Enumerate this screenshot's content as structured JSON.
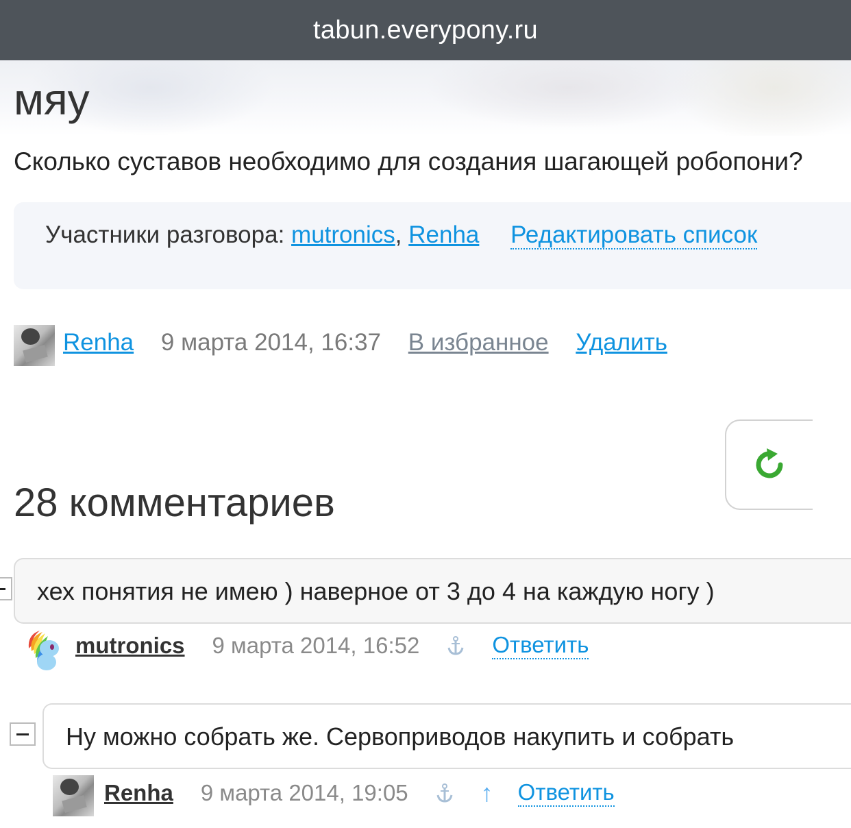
{
  "browser": {
    "url": "tabun.everypony.ru"
  },
  "talk": {
    "title": "мяу",
    "text": "Сколько суставов необходимо для создания шагающей робопони?",
    "participants_label": "Участники разговора:",
    "participants": [
      "mutronics",
      "Renha"
    ],
    "separator": ",",
    "edit_list_label": "Редактировать список",
    "author": "Renha",
    "date": "9 марта 2014, 16:37",
    "favourite_label": "В избранное",
    "delete_label": "Удалить"
  },
  "comments": {
    "header": "28 комментариев",
    "items": [
      {
        "text": "хех понятия не имею ) наверное от 3 до 4 на каждую ногу )",
        "author": "mutronics",
        "date": "9 марта 2014, 16:52",
        "reply_label": "Ответить"
      },
      {
        "text": "Ну можно собрать же. Сервоприводов накупить и собрать",
        "author": "Renha",
        "date": "9 марта 2014, 19:05",
        "parent_arrow": "↑",
        "reply_label": "Ответить"
      }
    ]
  },
  "colors": {
    "link": "#0f93e0",
    "urlbar": "#4e545a",
    "refresh": "#3aa832"
  },
  "icons": {
    "refresh": "refresh-icon",
    "anchor": "anchor-icon",
    "collapse": "minus-icon"
  }
}
